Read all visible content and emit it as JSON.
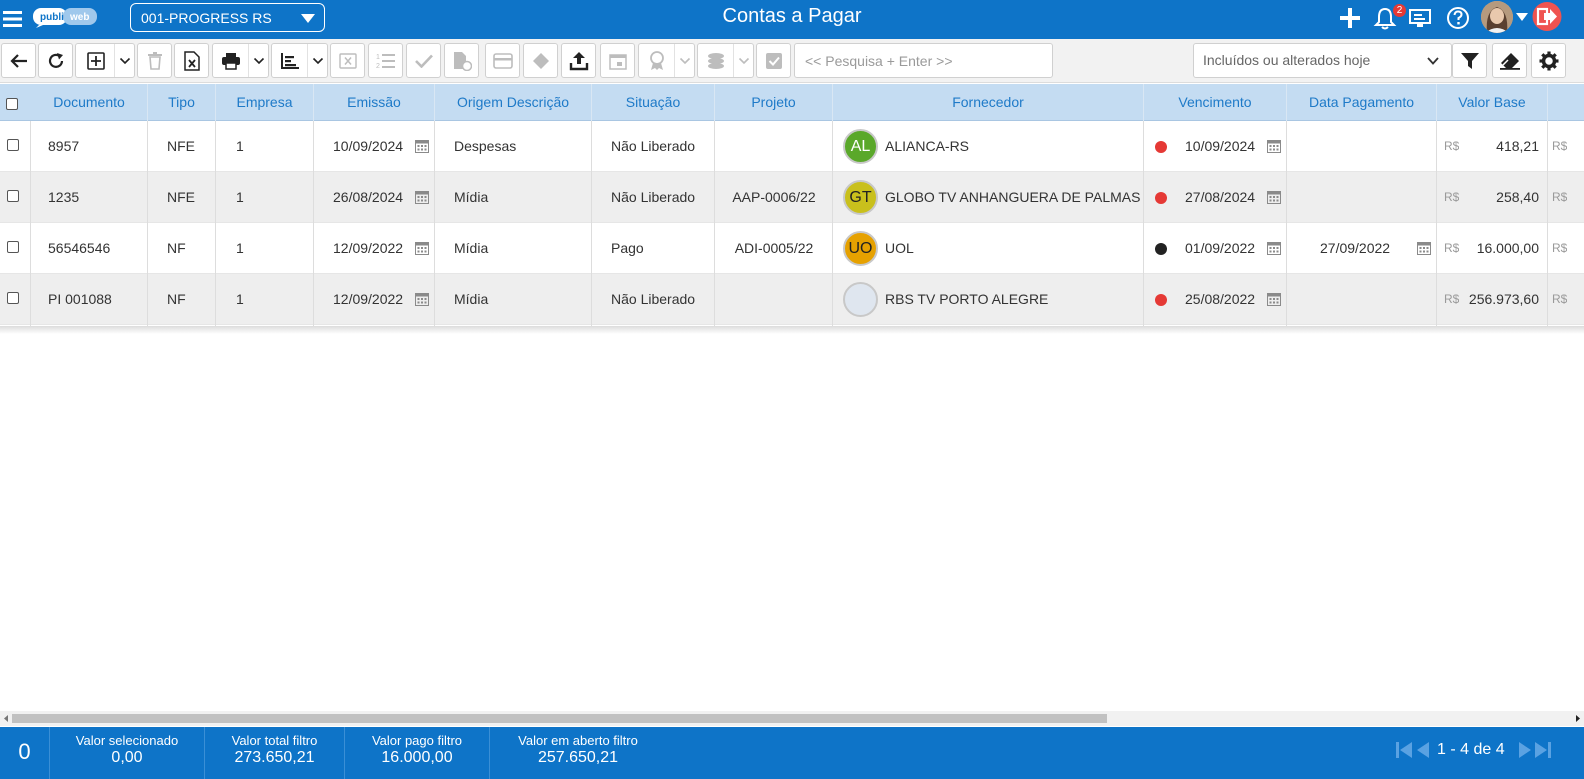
{
  "header": {
    "logo_text_a": "publi",
    "logo_text_b": "web",
    "company": "001-PROGRESS RS",
    "title": "Contas a Pagar",
    "notifications_count": "2",
    "accent": "#0e74c8"
  },
  "toolbar": {
    "search_placeholder": "<< Pesquisa + Enter >>",
    "filter_value": "Incluídos ou alterados hoje",
    "icons": [
      "back-icon",
      "refresh-icon",
      "add-icon",
      "delete-icon",
      "excel-icon",
      "print-icon",
      "chart-icon",
      "cancel-icon",
      "list-icon",
      "check-icon",
      "document-icon",
      "card-icon",
      "tag-icon",
      "upload-icon",
      "calendar-icon",
      "award-icon",
      "coins-icon",
      "approve-icon",
      "filter-icon",
      "eraser-icon",
      "gear-icon"
    ]
  },
  "table": {
    "columns": [
      "Documento",
      "Tipo",
      "Empresa",
      "Emissão",
      "Origem Descrição",
      "Situação",
      "Projeto",
      "Fornecedor",
      "Vencimento",
      "Data Pagamento",
      "Valor Base"
    ],
    "currency": "R$",
    "rows": [
      {
        "documento": "8957",
        "tipo": "NFE",
        "empresa": "1",
        "emissao": "10/09/2024",
        "origem": "Despesas",
        "situacao": "Não Liberado",
        "projeto": "",
        "fornecedor": "ALIANCA-RS",
        "avatar": "AL",
        "avatar_color": "#5aa82a",
        "avatar_text_color": "#ffffff",
        "status_color": "#e53935",
        "vencimento": "10/09/2024",
        "pagamento": "",
        "valor": "418,21"
      },
      {
        "documento": "1235",
        "tipo": "NFE",
        "empresa": "1",
        "emissao": "26/08/2024",
        "origem": "Mídia",
        "situacao": "Não Liberado",
        "projeto": "AAP-0006/22",
        "fornecedor": "GLOBO TV ANHANGUERA DE PALMAS",
        "avatar": "GT",
        "avatar_color": "#c9c01c",
        "avatar_text_color": "#222222",
        "status_color": "#e53935",
        "vencimento": "27/08/2024",
        "pagamento": "",
        "valor": "258,40"
      },
      {
        "documento": "56546546",
        "tipo": "NF",
        "empresa": "1",
        "emissao": "12/09/2022",
        "origem": "Mídia",
        "situacao": "Pago",
        "projeto": "ADI-0005/22",
        "fornecedor": "UOL",
        "avatar": "UO",
        "avatar_color": "#e6a100",
        "avatar_text_color": "#222222",
        "status_color": "#222222",
        "vencimento": "01/09/2022",
        "pagamento": "27/09/2022",
        "valor": "16.000,00"
      },
      {
        "documento": "PI 001088",
        "tipo": "NF",
        "empresa": "1",
        "emissao": "12/09/2022",
        "origem": "Mídia",
        "situacao": "Não Liberado",
        "projeto": "",
        "fornecedor": "RBS TV PORTO ALEGRE",
        "avatar": "",
        "avatar_color": "#dfe6ef",
        "avatar_text_color": "#222222",
        "status_color": "#e53935",
        "vencimento": "25/08/2022",
        "pagamento": "",
        "valor": "256.973,60"
      }
    ]
  },
  "footer": {
    "selected_count": "0",
    "summaries": [
      {
        "label": "Valor selecionado",
        "value": "0,00"
      },
      {
        "label": "Valor total filtro",
        "value": "273.650,21"
      },
      {
        "label": "Valor pago filtro",
        "value": "16.000,00"
      },
      {
        "label": "Valor em aberto filtro",
        "value": "257.650,21"
      }
    ],
    "pager": "1 - 4 de 4"
  }
}
